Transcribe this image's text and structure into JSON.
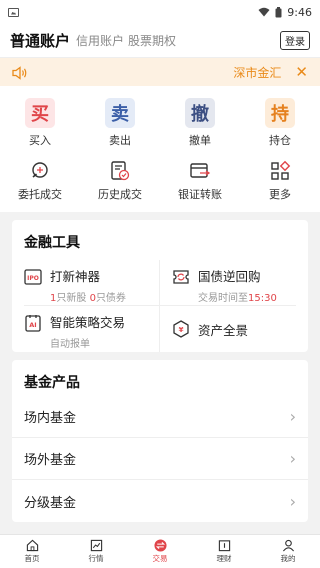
{
  "status_bar": {
    "time": "9:46"
  },
  "header": {
    "title": "普通账户",
    "tabs": [
      "信用账户",
      "股票期权"
    ],
    "login_label": "登录"
  },
  "notice": {
    "text": "深市金汇"
  },
  "quick_actions": [
    {
      "char": "买",
      "label": "买入"
    },
    {
      "char": "卖",
      "label": "卖出"
    },
    {
      "char": "撤",
      "label": "撤单"
    },
    {
      "char": "持",
      "label": "持仓"
    }
  ],
  "secondary_actions": [
    {
      "label": "委托成交",
      "icon": "search-icon"
    },
    {
      "label": "历史成交",
      "icon": "history-icon"
    },
    {
      "label": "银证转账",
      "icon": "transfer-icon"
    },
    {
      "label": "更多",
      "icon": "grid-icon"
    }
  ],
  "finance_tools": {
    "title": "金融工具",
    "items": [
      {
        "name": "打新神器",
        "sub_a_num": "1",
        "sub_a_text": "只新股 ",
        "sub_b_num": "0",
        "sub_b_text": "只债券",
        "icon": "ipo-icon"
      },
      {
        "name": "国债逆回购",
        "sub_text": "交易时间至",
        "sub_red": "15:30",
        "icon": "repo-icon"
      },
      {
        "name": "智能策略交易",
        "sub_text": "自动报单",
        "icon": "ai-icon"
      },
      {
        "name": "资产全景",
        "icon": "asset-icon"
      }
    ]
  },
  "fund_products": {
    "title": "基金产品",
    "items": [
      "场内基金",
      "场外基金",
      "分级基金"
    ]
  },
  "bottom_nav": [
    {
      "label": "首页",
      "icon": "home-icon"
    },
    {
      "label": "行情",
      "icon": "chart-icon"
    },
    {
      "label": "交易",
      "icon": "trade-icon"
    },
    {
      "label": "理财",
      "icon": "wallet-icon"
    },
    {
      "label": "我的",
      "icon": "user-icon"
    }
  ],
  "colors": {
    "accent_red": "#e0454a",
    "notice_orange": "#e98a19",
    "blue": "#3c5fa8"
  }
}
